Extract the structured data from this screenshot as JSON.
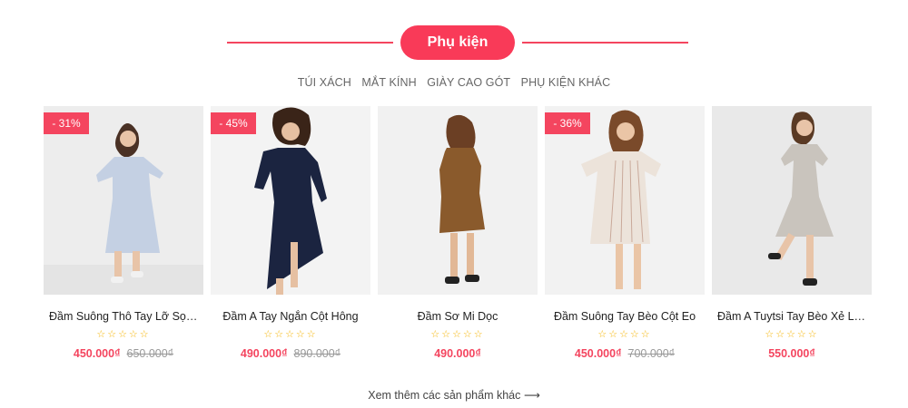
{
  "section": {
    "title": "Phụ kiện",
    "tabs": [
      "TÚI XÁCH",
      "MẮT KÍNH",
      "GIÀY CAO GÓT",
      "PHỤ KIỆN KHÁC"
    ]
  },
  "products": [
    {
      "name": "Đầm Suông Thô Tay Lỡ Sọc Xanh",
      "price": "450.000₫",
      "old_price": "650.000₫",
      "discount": "- 31%",
      "stars": "☆☆☆☆☆"
    },
    {
      "name": "Đầm A Tay Ngắn Cột Hông",
      "price": "490.000₫",
      "old_price": "890.000₫",
      "discount": "- 45%",
      "stars": "☆☆☆☆☆"
    },
    {
      "name": "Đầm Sơ Mi Dọc",
      "price": "490.000₫",
      "old_price": "",
      "discount": "",
      "stars": "☆☆☆☆☆"
    },
    {
      "name": "Đầm Suông Tay Bèo Cột Eo",
      "price": "450.000₫",
      "old_price": "700.000₫",
      "discount": "- 36%",
      "stars": "☆☆☆☆☆"
    },
    {
      "name": "Đầm A Tuytsi Tay Bèo Xẻ Lưng",
      "price": "550.000₫",
      "old_price": "",
      "discount": "",
      "stars": "☆☆☆☆☆"
    }
  ],
  "more_link": "Xem thêm các sản phẩm khác ⟶",
  "colors": {
    "accent": "#f93a58",
    "dress_1": "#c4d0e3",
    "dress_2": "#1b2440",
    "dress_3": "#8a5a2c",
    "dress_4": "#ece3da",
    "dress_5": "#c9c4bd"
  }
}
